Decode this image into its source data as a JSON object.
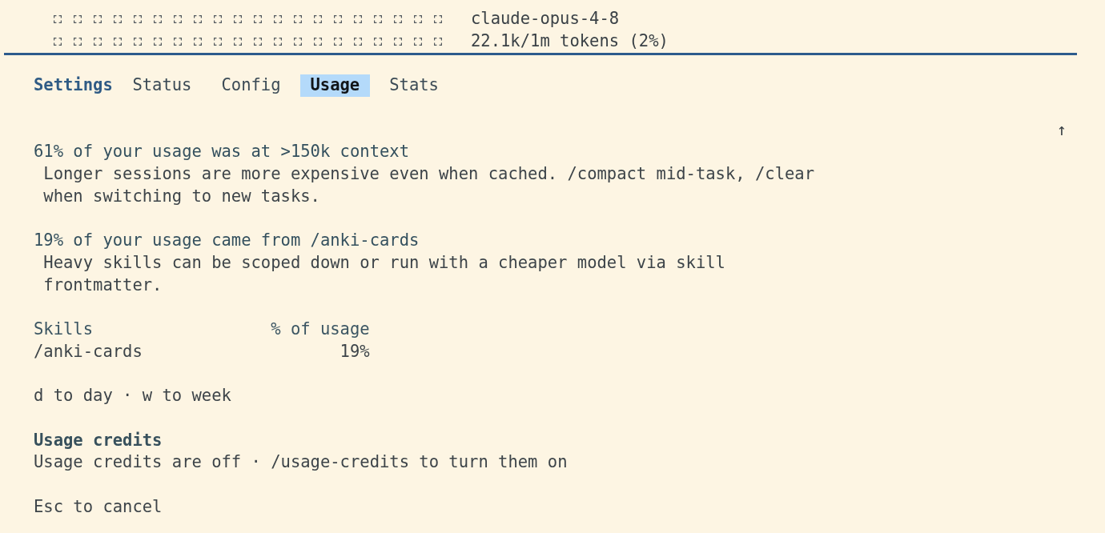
{
  "header": {
    "model": "claude-opus-4-8",
    "tokens": "22.1k/1m tokens (2%)"
  },
  "settings": {
    "title": "Settings",
    "tabs": [
      {
        "label": "Status",
        "selected": false
      },
      {
        "label": "Config",
        "selected": false
      },
      {
        "label": "Usage",
        "selected": true
      },
      {
        "label": "Stats",
        "selected": false
      }
    ]
  },
  "scroll_indicator": "↑",
  "insights": [
    {
      "headline": "61% of your usage was at >150k context",
      "detail": "Longer sessions are more expensive even when cached. /compact mid-task, /clear when switching to new tasks."
    },
    {
      "headline": "19% of your usage came from /anki-cards",
      "detail": "Heavy skills can be scoped down or run with a cheaper model via skill frontmatter."
    }
  ],
  "skills_table": {
    "columns": [
      "Skills",
      "% of usage"
    ],
    "rows": [
      [
        "/anki-cards",
        "19%"
      ]
    ]
  },
  "period_hint": "d to day · w to week",
  "usage_credits": {
    "title": "Usage credits",
    "text": "Usage credits are off · /usage-credits to turn them on"
  },
  "footer_hint": "Esc to cancel"
}
